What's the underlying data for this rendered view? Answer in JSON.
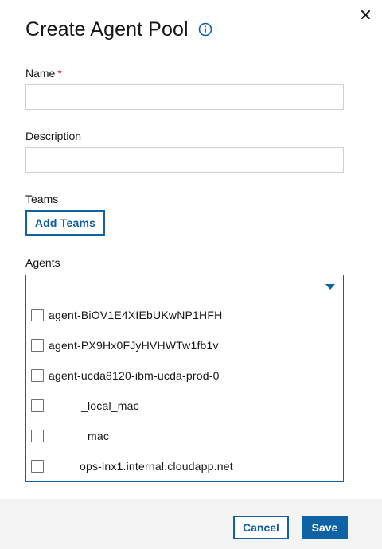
{
  "dialog": {
    "title": "Create Agent Pool",
    "close_icon": "close-icon",
    "info_icon": "info-icon"
  },
  "form": {
    "name_label": "Name",
    "name_required_mark": "*",
    "name_value": "",
    "description_label": "Description",
    "description_value": "",
    "teams_label": "Teams",
    "add_teams_label": "Add Teams",
    "agents_label": "Agents",
    "agents_selected": ""
  },
  "agents": [
    {
      "label": "agent-BiOV1E4XIEbUKwNP1HFH",
      "checked": false
    },
    {
      "label": "agent-PX9Hx0FJyHVHWTw1fb1v",
      "checked": false
    },
    {
      "label": "agent-ucda8120-ibm-ucda-prod-0",
      "checked": false
    },
    {
      "label": "_local_mac",
      "checked": false
    },
    {
      "label": "_mac",
      "checked": false
    },
    {
      "label": "ops-lnx1.internal.cloudapp.net",
      "checked": false
    }
  ],
  "footer": {
    "cancel_label": "Cancel",
    "save_label": "Save"
  },
  "colors": {
    "primary": "#0f62a4",
    "required": "#da1e28",
    "footer_bg": "#f4f4f4"
  }
}
